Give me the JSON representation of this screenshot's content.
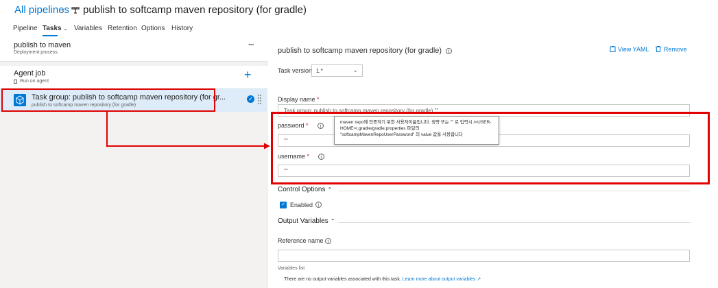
{
  "header": {
    "breadcrumb": "All pipelines",
    "title": "publish to softcamp maven repository (for gradle)",
    "tabs": [
      "Pipeline",
      "Tasks",
      "Variables",
      "Retention",
      "Options",
      "History"
    ]
  },
  "left": {
    "stage": {
      "title": "publish to maven",
      "subtitle": "Deployment process"
    },
    "agent_job": {
      "title": "Agent job",
      "subtitle": "Run on agent"
    },
    "task": {
      "title": "Task group: publish to softcamp maven repository (for gr...",
      "subtitle": "publish to softcamp maven repository (for gradle)"
    }
  },
  "right": {
    "title": "publish to softcamp maven repository (for gradle)",
    "view_yaml": "View YAML",
    "remove": "Remove",
    "task_version_label": "Task version",
    "task_version_value": "1.*",
    "display_name_label": "Display name",
    "display_name_value": "Task group: publish to softcamp maven repository (for gradle) \"\"",
    "password_label": "password",
    "password_value": "\"\"",
    "username_label": "username",
    "username_value": "\"\"",
    "tooltip_text": "maven repo에 인증하기 위한 사용자이름입니다. 생략 또는 \"\" 로 입력시 /<USER-HOME>/.gradle/gradle.properties 파일의 \"softcampMavenRepoUserPassword\" 의 value 값을 사용합니다",
    "control_options_label": "Control Options",
    "enabled_label": "Enabled",
    "output_variables_label": "Output Variables",
    "reference_name_label": "Reference name",
    "reference_name_value": "",
    "variables_list_label": "Variables list",
    "no_output_text": "There are no output variables associated with this task.",
    "learn_more_text": "Learn more about output variables"
  },
  "colors": {
    "accent": "#0078d4",
    "annotation": "#e00000",
    "selected": "#deecf9"
  }
}
